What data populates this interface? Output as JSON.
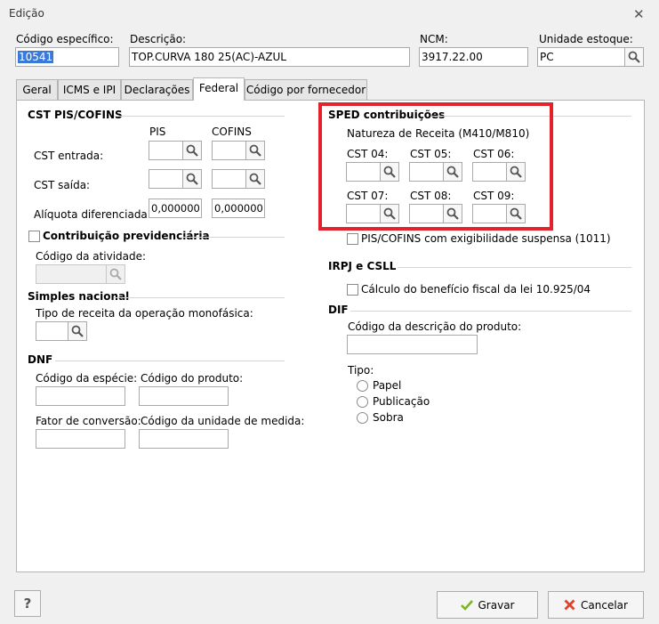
{
  "window": {
    "title": "Edição"
  },
  "header": {
    "codigo_label": "Código específico:",
    "codigo_value": "10541",
    "descricao_label": "Descrição:",
    "descricao_value": "TOP.CURVA 180 25(AC)-AZUL",
    "ncm_label": "NCM:",
    "ncm_value": "3917.22.00",
    "unidade_label": "Unidade estoque:",
    "unidade_value": "PC"
  },
  "tabs": [
    "Geral",
    "ICMS e IPI",
    "Declarações",
    "Federal",
    "Código por fornecedor"
  ],
  "active_tab": "Federal",
  "cst": {
    "title": "CST PIS/COFINS",
    "pis_label": "PIS",
    "cofins_label": "COFINS",
    "entrada_label": "CST entrada:",
    "saida_label": "CST saída:",
    "aliquota_label": "Alíquota diferenciada:",
    "aliquota_pis": "0,000000",
    "aliquota_cofins": "0,000000"
  },
  "previdenciaria": {
    "label": "Contribuição previdenciária",
    "atividade_label": "Código da atividade:"
  },
  "simples": {
    "title": "Simples nacional",
    "tipo_label": "Tipo de receita da operação monofásica:"
  },
  "dnf": {
    "title": "DNF",
    "especie_label": "Código da espécie:",
    "produto_label": "Código do produto:",
    "fator_label": "Fator de conversão:",
    "unidade_label": "Código da unidade de medida:"
  },
  "sped": {
    "title": "SPED contribuições",
    "natureza_label": "Natureza de Receita (M410/M810)",
    "cst04": "CST 04:",
    "cst05": "CST 05:",
    "cst06": "CST 06:",
    "cst07": "CST 07:",
    "cst08": "CST 08:",
    "cst09": "CST 09:",
    "suspensa_label": "PIS/COFINS com exigibilidade suspensa (1011)"
  },
  "irpj": {
    "title": "IRPJ e CSLL",
    "calculo_label": "Cálculo do benefício fiscal da lei 10.925/04"
  },
  "dif": {
    "title": "DIF",
    "descricao_label": "Código da descrição do produto:",
    "tipo_label": "Tipo:",
    "options": [
      "Papel",
      "Publicação",
      "Sobra"
    ]
  },
  "buttons": {
    "help": "?",
    "gravar": "Gravar",
    "cancelar": "Cancelar"
  },
  "colors": {
    "highlight": "#e3232b",
    "selection": "#3879d9"
  }
}
